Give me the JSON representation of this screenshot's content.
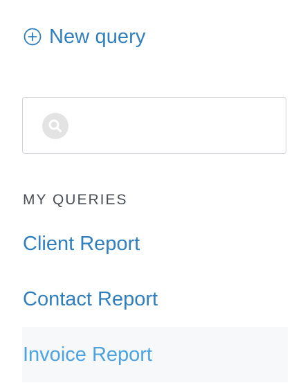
{
  "new_query": {
    "icon": "plus-circle-icon",
    "label": "New query"
  },
  "search": {
    "icon": "search-icon",
    "value": "",
    "placeholder": ""
  },
  "my_queries": {
    "title": "MY QUERIES",
    "items": [
      {
        "label": "Client Report",
        "active": false
      },
      {
        "label": "Contact Report",
        "active": false
      },
      {
        "label": "Invoice Report",
        "active": true
      }
    ]
  },
  "colors": {
    "link": "#2f7fbf",
    "link_active": "#4da3e0",
    "active_row_bg": "#f7f8fa",
    "border": "#cfd3d7",
    "search_icon_bg": "#e3e3e3"
  }
}
